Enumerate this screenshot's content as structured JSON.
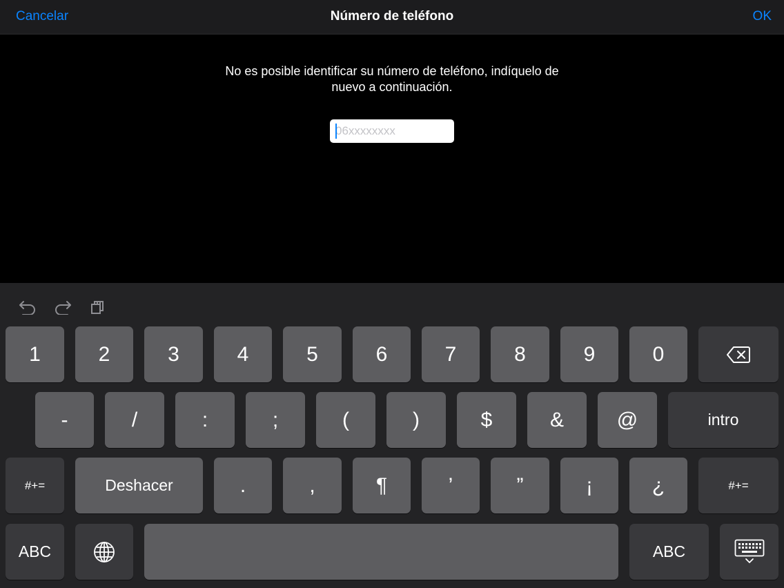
{
  "navbar": {
    "cancel_label": "Cancelar",
    "title": "Número de teléfono",
    "ok_label": "OK"
  },
  "content": {
    "message_line1": "No es posible identificar su número de teléfono, indíquelo de",
    "message_line2": "nuevo a continuación.",
    "phone_field": {
      "value": "",
      "placeholder": "06xxxxxxxx"
    }
  },
  "colors": {
    "accent": "#0a84ff",
    "background": "#000000",
    "navbar": "#1c1c1e",
    "keyboard": "#232325",
    "key": "#5d5d60",
    "key_dark": "#39393c"
  },
  "keyboard": {
    "toolbar": [
      "undo-icon",
      "redo-icon",
      "paste-icon"
    ],
    "row1": [
      "1",
      "2",
      "3",
      "4",
      "5",
      "6",
      "7",
      "8",
      "9",
      "0"
    ],
    "row1_end": "backspace-icon",
    "row2": [
      "-",
      "/",
      ":",
      ";",
      "(",
      ")",
      "$",
      "&",
      "@"
    ],
    "row2_end": "intro",
    "row3_start": "#+=",
    "row3_undo": "Deshacer",
    "row3": [
      ".",
      ",",
      "¶",
      "’",
      "”",
      "¡",
      "¿"
    ],
    "row3_end": "#+=",
    "row4_abc_left": "ABC",
    "row4_globe": "globe-icon",
    "row4_space": "",
    "row4_abc_right": "ABC",
    "row4_hide": "keyboard-dismiss-icon"
  }
}
